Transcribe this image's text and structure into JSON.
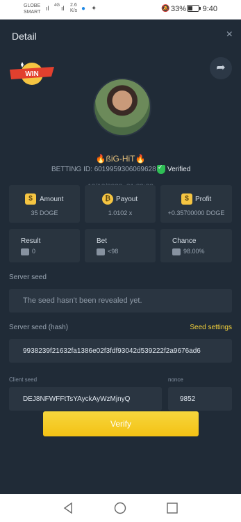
{
  "status_bar": {
    "carrier_line1": "GLOBE",
    "carrier_line2": "SMART",
    "signal1": "ıl",
    "signal2": "ıl",
    "net_type": "4G",
    "speed_value": "2.6",
    "speed_unit": "K/s",
    "battery_percent": "33%",
    "time": "9:40"
  },
  "header": {
    "title": "Detail",
    "close_glyph": "×"
  },
  "badge": {
    "text": "WIN"
  },
  "user": {
    "name": "🔥ßiG-HiT🔥",
    "betting_id_label": "BETTING ID:",
    "betting_id": "6019959306069628",
    "verified_label": "Verified",
    "date": "19/12/2020, 21:39:20"
  },
  "stats": {
    "amount": {
      "label": "Amount",
      "value": "35 DOGE"
    },
    "payout": {
      "label": "Payout",
      "value": "1.0102 x"
    },
    "profit": {
      "label": "Profit",
      "value": "+0.35700000 DOGE"
    },
    "result": {
      "label": "Result",
      "value": "0"
    },
    "bet": {
      "label": "Bet",
      "value": "<98"
    },
    "chance": {
      "label": "Chance",
      "value": "98.00%"
    }
  },
  "server_seed": {
    "label": "Server seed",
    "value": "The seed hasn't been revealed yet."
  },
  "server_seed_hash": {
    "label": "Server seed (hash)",
    "settings_link": "Seed settings",
    "value": "9938239f21632fa1386e02f3fdf93042d539222f2a9676ad6"
  },
  "client_seed": {
    "label": "Client seed",
    "value": "DEJ8NFWFFtTsYAyckAyWzMjnyQ"
  },
  "nonce": {
    "label": "nonce",
    "value": "9852"
  },
  "verify_button": {
    "label": "Verify"
  },
  "colors": {
    "accent": "#f4c214",
    "background": "#202b37",
    "card": "#29343f",
    "verified": "#2fbf56"
  }
}
